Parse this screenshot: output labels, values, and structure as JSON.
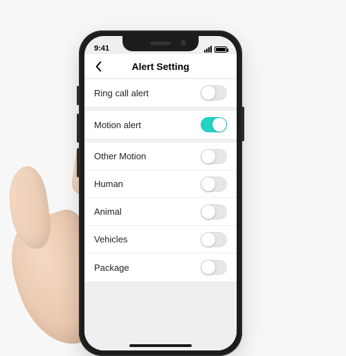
{
  "status": {
    "time": "9:41"
  },
  "nav": {
    "title": "Alert Setting"
  },
  "colors": {
    "accent": "#22d3c6"
  },
  "groups": [
    {
      "rows": [
        {
          "label": "Ring call alert",
          "on": false
        }
      ]
    },
    {
      "rows": [
        {
          "label": "Motion alert",
          "on": true
        }
      ]
    },
    {
      "rows": [
        {
          "label": "Other Motion",
          "on": false
        },
        {
          "label": "Human",
          "on": false
        },
        {
          "label": "Animal",
          "on": false
        },
        {
          "label": "Vehicles",
          "on": false
        },
        {
          "label": "Package",
          "on": false
        }
      ]
    }
  ]
}
